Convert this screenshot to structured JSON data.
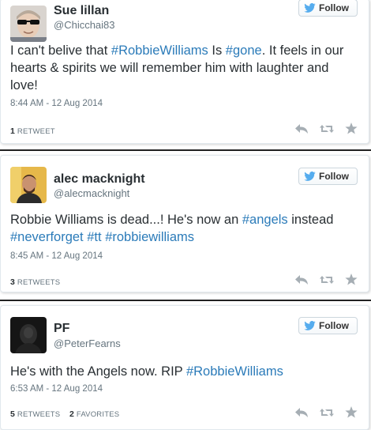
{
  "follow_label": "Follow",
  "colors": {
    "hashtag": "#2b7bb9",
    "text": "#292f33",
    "muted": "#66757f",
    "follow_bird": "#55acee"
  },
  "tweets": [
    {
      "name": "Sue lillan",
      "handle": "@Chicchai83",
      "text": [
        {
          "t": "I can't belive that ",
          "tag": false
        },
        {
          "t": "#RobbieWilliams",
          "tag": true
        },
        {
          "t": " Is ",
          "tag": false
        },
        {
          "t": "#gone",
          "tag": true
        },
        {
          "t": ". It feels in our hearts & spirits  we will remember him with laughter and love!",
          "tag": false
        }
      ],
      "time": "8:44 AM - 12 Aug 2014",
      "retweets": "1",
      "retweets_label": "RETWEET",
      "favorites": "",
      "favorites_label": ""
    },
    {
      "name": "alec macknight",
      "handle": "@alecmacknight",
      "text": [
        {
          "t": "Robbie Williams is dead...! He's now an ",
          "tag": false
        },
        {
          "t": "#angels",
          "tag": true
        },
        {
          "t": " instead ",
          "tag": false
        },
        {
          "t": "#neverforget",
          "tag": true
        },
        {
          "t": " ",
          "tag": false
        },
        {
          "t": "#tt",
          "tag": true
        },
        {
          "t": " ",
          "tag": false
        },
        {
          "t": "#robbiewilliams",
          "tag": true
        }
      ],
      "time": "8:45 AM - 12 Aug 2014",
      "retweets": "3",
      "retweets_label": "RETWEETS",
      "favorites": "",
      "favorites_label": ""
    },
    {
      "name": "PF",
      "handle": "@PeterFearns",
      "text": [
        {
          "t": "He's with the Angels now. RIP ",
          "tag": false
        },
        {
          "t": "#RobbieWilliams",
          "tag": true
        }
      ],
      "time": "6:53 AM - 12 Aug 2014",
      "retweets": "5",
      "retweets_label": "RETWEETS",
      "favorites": "2",
      "favorites_label": "FAVORITES"
    }
  ]
}
